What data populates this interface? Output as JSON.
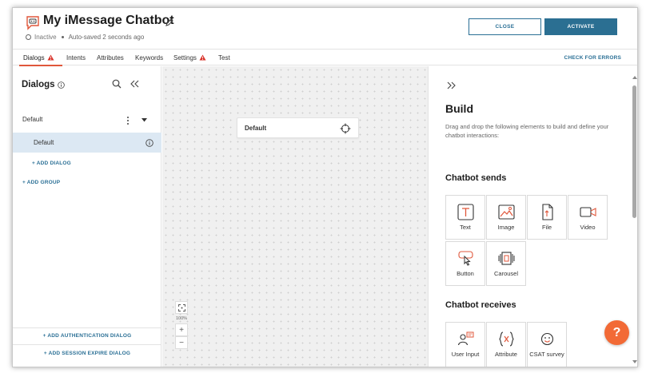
{
  "header": {
    "title": "My iMessage Chatbot",
    "status": "Inactive",
    "autosaved": "Auto-saved 2 seconds ago",
    "close_label": "CLOSE",
    "activate_label": "ACTIVATE"
  },
  "tabs": [
    {
      "label": "Dialogs",
      "warning": true,
      "active": true
    },
    {
      "label": "Intents",
      "warning": false
    },
    {
      "label": "Attributes",
      "warning": false
    },
    {
      "label": "Keywords",
      "warning": false
    },
    {
      "label": "Settings",
      "warning": true
    },
    {
      "label": "Test",
      "warning": false
    }
  ],
  "check_errors_label": "CHECK FOR ERRORS",
  "sidebar": {
    "title": "Dialogs",
    "group_label": "Default",
    "dialog_label": "Default",
    "add_dialog": "+ ADD DIALOG",
    "add_group": "+ ADD GROUP",
    "add_auth_dialog": "+ ADD AUTHENTICATION DIALOG",
    "add_session_expire_dialog": "+ ADD SESSION EXPIRE DIALOG"
  },
  "canvas": {
    "node_label": "Default",
    "zoom_level": "100%",
    "zoom_in": "+",
    "zoom_out": "−"
  },
  "panel": {
    "title": "Build",
    "description": "Drag and drop the following elements to build and define your chatbot interactions:",
    "sends_title": "Chatbot sends",
    "sends_items": [
      {
        "label": "Text",
        "icon": "text-icon"
      },
      {
        "label": "Image",
        "icon": "image-icon"
      },
      {
        "label": "File",
        "icon": "file-icon"
      },
      {
        "label": "Video",
        "icon": "video-icon"
      },
      {
        "label": "Button",
        "icon": "button-icon"
      },
      {
        "label": "Carousel",
        "icon": "carousel-icon"
      }
    ],
    "receives_title": "Chatbot receives",
    "receives_items": [
      {
        "label": "User Input",
        "icon": "user-input-icon"
      },
      {
        "label": "Attribute",
        "icon": "attribute-icon"
      },
      {
        "label": "CSAT survey",
        "icon": "csat-icon"
      }
    ],
    "help_label": "?"
  },
  "colors": {
    "accent_orange": "#f26a36",
    "primary_blue": "#2b6f92",
    "warning_red": "#d9342b",
    "selected_row": "#dce8f3"
  }
}
